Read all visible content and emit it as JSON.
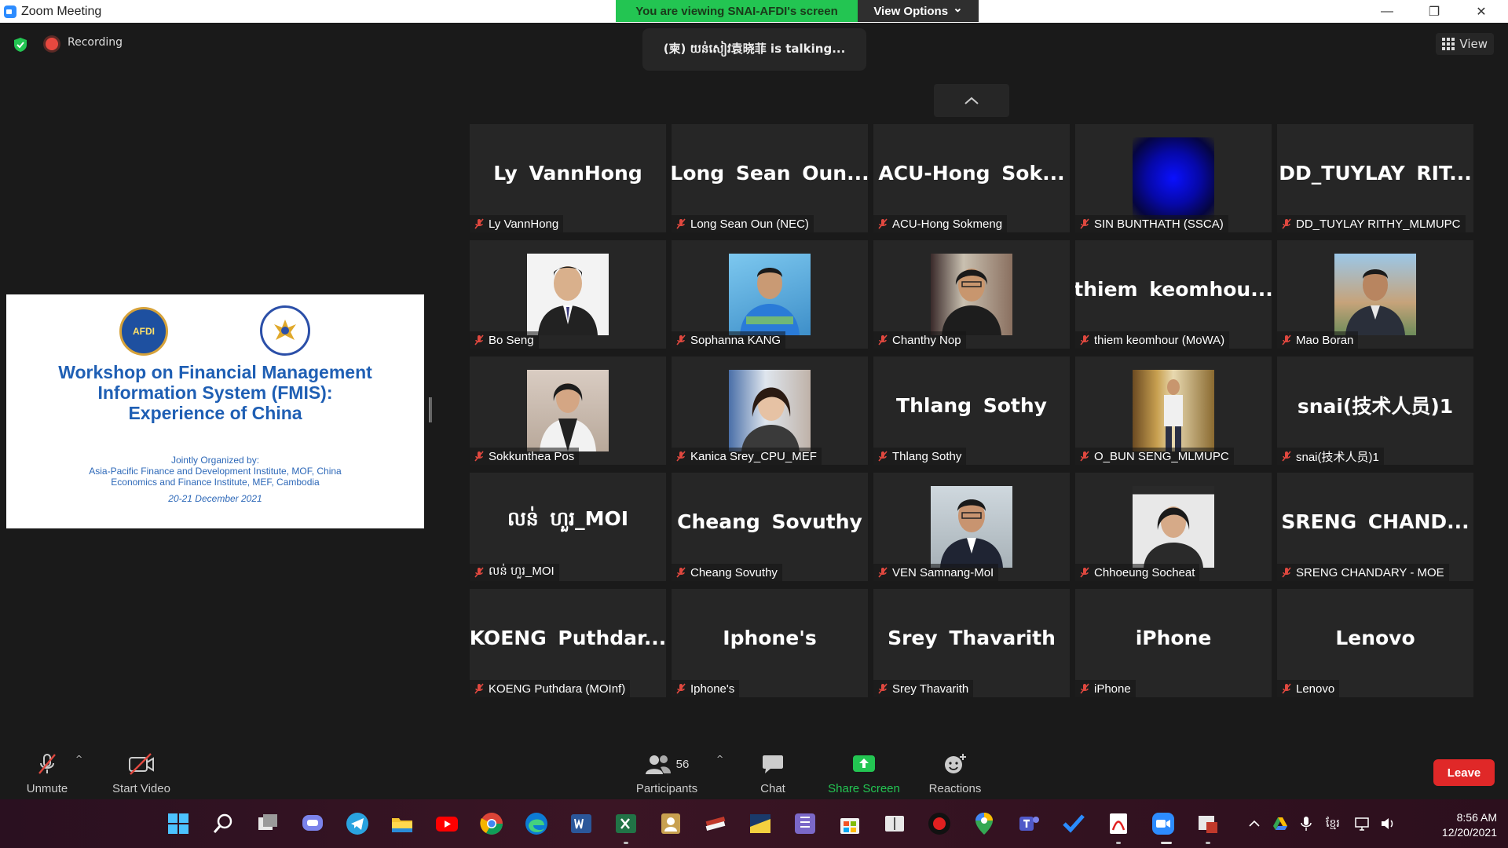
{
  "window": {
    "title": "Zoom Meeting",
    "minimize_icon": "—",
    "restore_icon": "❐",
    "close_icon": "✕"
  },
  "share_banner": {
    "text": "You are viewing SNAI-AFDI's screen",
    "view_options": "View Options",
    "caret": "⌄"
  },
  "meeting_bar": {
    "recording_label": "Recording",
    "talking": "(柬) យន់សៀវ袁晓菲 is talking...",
    "view_label": "View"
  },
  "shared_screen": {
    "logo_text": "AFDI",
    "title_lines": [
      "Workshop on Financial Management",
      "Information System (FMIS):",
      "Experience of China"
    ],
    "org_lines": [
      "Jointly Organized by:",
      "Asia-Pacific Finance and Development Institute, MOF, China",
      "Economics and Finance Institute, MEF, Cambodia"
    ],
    "date": "20-21 December 2021"
  },
  "participants": [
    {
      "big": "Ly VannHong",
      "label": "Ly VannHong"
    },
    {
      "big": "Long Sean Oun...",
      "label": "Long Sean Oun (NEC)"
    },
    {
      "big": "ACU-Hong Sok...",
      "label": "ACU-Hong Sokmeng"
    },
    {
      "big": "",
      "label": "SIN BUNTHATH (SSCA)"
    },
    {
      "big": "DD_TUYLAY RIT...",
      "label": "DD_TUYLAY RITHY_MLMUPC"
    },
    {
      "big": "",
      "label": "Bo Seng"
    },
    {
      "big": "",
      "label": "Sophanna KANG"
    },
    {
      "big": "",
      "label": "Chanthy Nop"
    },
    {
      "big": "thiem keomhou...",
      "label": "thiem keomhour (MoWA)"
    },
    {
      "big": "",
      "label": "Mao Boran"
    },
    {
      "big": "",
      "label": "Sokkunthea Pos"
    },
    {
      "big": "",
      "label": "Kanica Srey_CPU_MEF"
    },
    {
      "big": "Thlang Sothy",
      "label": "Thlang Sothy"
    },
    {
      "big": "",
      "label": "O_BUN SENG_MLMUPC"
    },
    {
      "big": "snai(技术人员)1",
      "label": "snai(技术人员)1"
    },
    {
      "big": "លន់ ហួរ_MOI",
      "label": "លន់ ហួរ_MOI"
    },
    {
      "big": "Cheang Sovuthy",
      "label": "Cheang Sovuthy"
    },
    {
      "big": "",
      "label": "VEN Samnang-MoI"
    },
    {
      "big": "",
      "label": "Chhoeung Socheat"
    },
    {
      "big": "SRENG CHAND...",
      "label": "SRENG CHANDARY - MOE"
    },
    {
      "big": "KOENG Puthdar...",
      "label": "KOENG Puthdara (MOInf)"
    },
    {
      "big": "Iphone's",
      "label": "Iphone's"
    },
    {
      "big": "Srey Thavarith",
      "label": "Srey Thavarith"
    },
    {
      "big": "iPhone",
      "label": "iPhone"
    },
    {
      "big": "Lenovo",
      "label": "Lenovo"
    }
  ],
  "toolbar": {
    "unmute": "Unmute",
    "start_video": "Start Video",
    "participants": "Participants",
    "participant_count": "56",
    "chat": "Chat",
    "share_screen": "Share Screen",
    "reactions": "Reactions",
    "leave": "Leave",
    "caret": "^"
  },
  "taskbar": {
    "input_lang": "ខ្មែរ",
    "time": "8:56 AM",
    "date": "12/20/2021"
  },
  "colors": {
    "accent_green": "#23c552",
    "leave_red": "#e02828",
    "tile_bg": "#262626"
  }
}
